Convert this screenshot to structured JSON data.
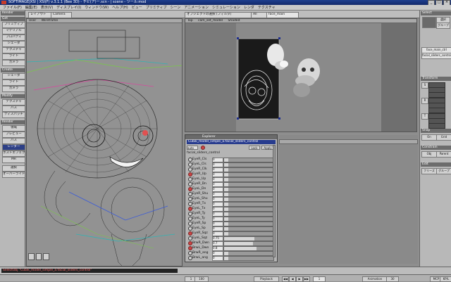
{
  "app": {
    "title": "SOFTIMAGE|XSI | XSI(F) v.3.1.1 (Bee 3D) - チビ(ア)ー.scn - | scene - ツール:mod",
    "window_controls": [
      "_",
      "□",
      "×"
    ]
  },
  "menubar": [
    "ファイル(F)",
    "編集(E)",
    "表示(V)",
    "ディスプレイ(I)",
    "ウィンドウ(W)",
    "ヘルプ(H)",
    "ビュー",
    "プリミティブ",
    "シーン",
    "アニメーション",
    "シミュレーション",
    "レンダ",
    "テクスチャ"
  ],
  "toolbar": {
    "layout_label": "レイアウト",
    "view_label": "Camera",
    "selection_filter": "オブジェクトの選択 (フィルタ)",
    "display_mode": "All",
    "scene_field": "face_main"
  },
  "left_panel": {
    "header": "Render",
    "sections": [
      {
        "title": "Get",
        "items": [
          "プリミティブ",
          "マテリアル",
          "プロパティ",
          "シェーダ",
          "テクスチャ",
          "ライト",
          "カメラ"
        ]
      },
      {
        "title": "Create",
        "items": [
          "シェーダ",
          "ライト",
          "カメラ"
        ]
      },
      {
        "title": "Modify",
        "items": [
          "テクスチャ",
          "パス",
          "ディスパッチ"
        ]
      },
      {
        "title": "Render",
        "items": [
          "領域",
          "プレビュー",
          "パス",
          "レンダー",
          "ポストエフェクト",
          "MR"
        ]
      }
    ],
    "bottom_buttons": [
      "選択",
      "オーバーライド"
    ],
    "selected_item": "レンダー"
  },
  "viewport_left": {
    "header": "User",
    "shading": "Wireframe"
  },
  "viewport_right": {
    "header": "Top",
    "camera_label": "cam_set_model",
    "shading": "Shaded"
  },
  "explorer": {
    "title": "Explorer",
    "path": "Cubik_model_simple_a.facial_sliders_control",
    "controls": {
      "mode": "auto",
      "lock": "Lock",
      "apply": "Apply"
    },
    "node_label": "facial_sliders_control",
    "params": [
      {
        "name": "EyeR_Cls",
        "value": "0",
        "fill": 0.08,
        "animated": false
      },
      {
        "name": "EyeL_Cls",
        "value": "0",
        "fill": 0.08,
        "animated": false
      },
      {
        "name": "EyeR_Clk",
        "value": "0",
        "fill": 0.08,
        "animated": false
      },
      {
        "name": "EyeR_Up",
        "value": "0",
        "fill": 0.08,
        "animated": true
      },
      {
        "name": "EyeL_Up",
        "value": "0",
        "fill": 0.08,
        "animated": false
      },
      {
        "name": "EyeR_Dn",
        "value": "0",
        "fill": 0.08,
        "animated": false
      },
      {
        "name": "EyeL_Dn",
        "value": "0",
        "fill": 0.08,
        "animated": true
      },
      {
        "name": "EyeR_Shu",
        "value": "0",
        "fill": 0.08,
        "animated": false
      },
      {
        "name": "EyeL_Shu",
        "value": "0",
        "fill": 0.08,
        "animated": false
      },
      {
        "name": "EyeR_Tx",
        "value": "0",
        "fill": 0.08,
        "animated": false
      },
      {
        "name": "EyeL_Tx",
        "value": "0",
        "fill": 0.08,
        "animated": true
      },
      {
        "name": "EyeR_Ty",
        "value": "0",
        "fill": 0.08,
        "animated": false
      },
      {
        "name": "EyeL_Ty",
        "value": "0",
        "fill": 0.08,
        "animated": false
      },
      {
        "name": "EyeR_Sp",
        "value": "0",
        "fill": 0.08,
        "animated": false
      },
      {
        "name": "EyeL_Sp",
        "value": "0",
        "fill": 0.08,
        "animated": false
      },
      {
        "name": "EyeR_Sqz",
        "value": "0",
        "fill": 0.08,
        "animated": true
      },
      {
        "name": "EyeL_Sqz",
        "value": "0.75",
        "fill": 0.62,
        "animated": false
      },
      {
        "name": "BrwR_Dwn",
        "value": "0.7",
        "fill": 0.58,
        "animated": true
      },
      {
        "name": "BrwL_Dwn",
        "value": "0.8",
        "fill": 0.66,
        "animated": true
      },
      {
        "name": "BrwR_ang",
        "value": "0",
        "fill": 0.08,
        "animated": false
      },
      {
        "name": "BrwL_ang",
        "value": "0",
        "fill": 0.08,
        "animated": false
      }
    ]
  },
  "right_panel": {
    "top_header": "Select",
    "select_items": [
      "選択",
      "グループ"
    ],
    "object_field": "face_main_ctrl",
    "object_field2": "facial_sliders_control",
    "sections": [
      {
        "title": "Transform",
        "items": [
          "S",
          "R",
          "T"
        ]
      },
      {
        "title": "Snap",
        "items": [
          "On",
          "Grid"
        ]
      },
      {
        "title": "Constrain",
        "items": [
          "Obj",
          "Parent"
        ]
      },
      {
        "title": "Edit",
        "items": [
          "フリーズ",
          "グループ"
        ]
      }
    ]
  },
  "command_line": {
    "text": "SelectObj \"Cubik_model_simple_a.facial_sliders_control\""
  },
  "status_bar": {
    "frame_start": "1",
    "frame_end": "100",
    "current_frame": "1",
    "playback_label": "Playback",
    "animation_label": "Animation",
    "fps": "30",
    "buttons": [
      "MCP",
      "KP/L"
    ]
  }
}
